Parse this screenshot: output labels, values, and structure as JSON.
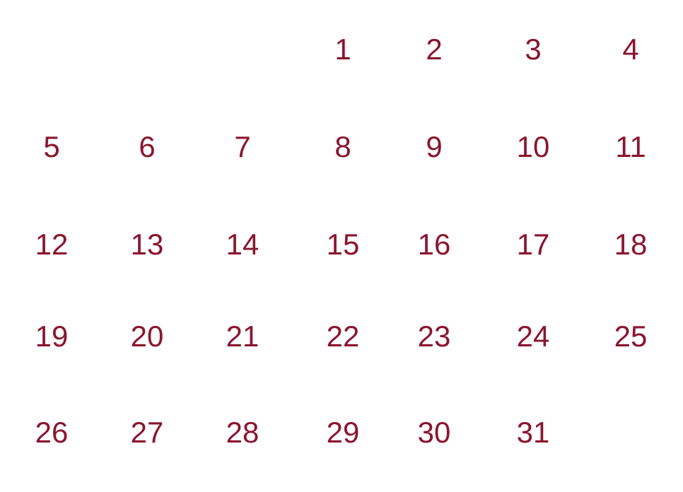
{
  "calendar": {
    "accent_color": "#8a1530",
    "leading_blank_days": 3,
    "days_per_week": 7,
    "days": [
      "1",
      "2",
      "3",
      "4",
      "5",
      "6",
      "7",
      "8",
      "9",
      "10",
      "11",
      "12",
      "13",
      "14",
      "15",
      "16",
      "17",
      "18",
      "19",
      "20",
      "21",
      "22",
      "23",
      "24",
      "25",
      "26",
      "27",
      "28",
      "29",
      "30",
      "31"
    ]
  }
}
